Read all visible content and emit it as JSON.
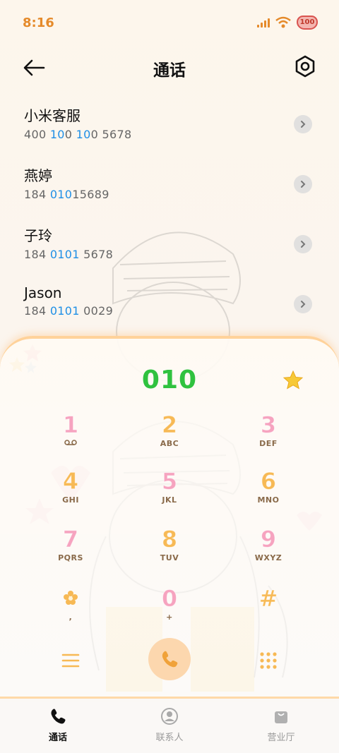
{
  "status_bar": {
    "time": "8:16",
    "battery": "100"
  },
  "header": {
    "title": "通话"
  },
  "contacts": [
    {
      "name": "小米客服",
      "number_parts": [
        "400 ",
        "10",
        "0 ",
        "10",
        "0 5678"
      ],
      "highlight": [
        false,
        true,
        false,
        true,
        false
      ]
    },
    {
      "name": "燕婷",
      "number_parts": [
        "184 ",
        "010",
        "15689"
      ],
      "highlight": [
        false,
        true,
        false
      ]
    },
    {
      "name": "子玲",
      "number_parts": [
        "184 ",
        "0101",
        " 5678"
      ],
      "highlight": [
        false,
        true,
        false
      ]
    },
    {
      "name": "Jason",
      "number_parts": [
        "184 ",
        "0101",
        " 0029"
      ],
      "highlight": [
        false,
        true,
        false
      ]
    }
  ],
  "dialer": {
    "input_value": "010",
    "keys": [
      {
        "digit": "1",
        "letters": "",
        "icon": "voicemail-icon",
        "color": "pink"
      },
      {
        "digit": "2",
        "letters": "ABC",
        "color": "orange"
      },
      {
        "digit": "3",
        "letters": "DEF",
        "color": "pink"
      },
      {
        "digit": "4",
        "letters": "GHI",
        "color": "orange"
      },
      {
        "digit": "5",
        "letters": "JKL",
        "color": "pink"
      },
      {
        "digit": "6",
        "letters": "MNO",
        "color": "orange"
      },
      {
        "digit": "7",
        "letters": "PQRS",
        "color": "pink"
      },
      {
        "digit": "8",
        "letters": "TUV",
        "color": "orange"
      },
      {
        "digit": "9",
        "letters": "WXYZ",
        "color": "pink"
      },
      {
        "digit": "*",
        "letters": ",",
        "icon": "flower-star-icon",
        "color": "orange"
      },
      {
        "digit": "0",
        "letters": "+",
        "color": "pink"
      },
      {
        "digit": "#",
        "letters": "",
        "color": "orange"
      }
    ]
  },
  "tabs": [
    {
      "label": "通话",
      "icon": "phone-icon",
      "active": true
    },
    {
      "label": "联系人",
      "icon": "contacts-icon",
      "active": false
    },
    {
      "label": "营业厅",
      "icon": "store-bag-icon",
      "active": false
    }
  ],
  "colors": {
    "accent_orange": "#f7b955",
    "accent_pink": "#f6a3bf",
    "dial_green": "#2fc23f",
    "highlight_blue": "#1e8fe6",
    "time_orange": "#e58a2a"
  }
}
